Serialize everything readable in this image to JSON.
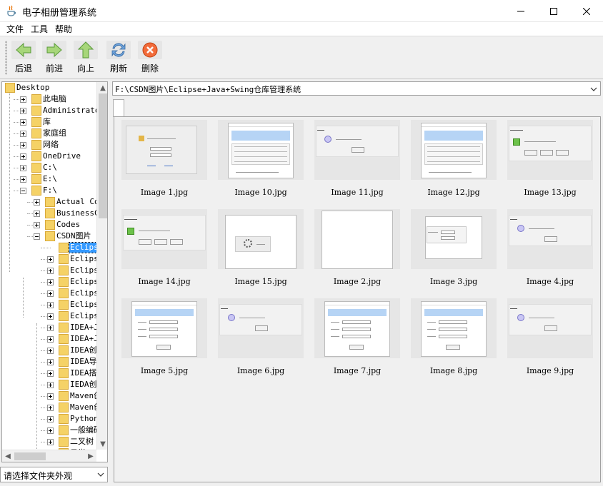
{
  "window": {
    "title": "电子相册管理系统",
    "controls": [
      "minimize",
      "maximize",
      "close"
    ]
  },
  "menu": [
    "文件",
    "工具",
    "帮助"
  ],
  "toolbar": [
    {
      "label": "后退",
      "icon": "back-arrow-icon"
    },
    {
      "label": "前进",
      "icon": "forward-arrow-icon"
    },
    {
      "label": "向上",
      "icon": "up-arrow-icon"
    },
    {
      "label": "刷新",
      "icon": "refresh-icon"
    },
    {
      "label": "删除",
      "icon": "delete-icon"
    }
  ],
  "tree": {
    "items": [
      {
        "label": "Desktop",
        "expanded": true
      },
      {
        "label": "此电脑"
      },
      {
        "label": "Administrator"
      },
      {
        "label": "库"
      },
      {
        "label": "家庭组"
      },
      {
        "label": "网络"
      },
      {
        "label": "OneDrive"
      },
      {
        "label": "C:\\"
      },
      {
        "label": "E:\\"
      },
      {
        "label": "F:\\",
        "expanded": true
      },
      {
        "label": "Actual Combat"
      },
      {
        "label": "BusinessCodes"
      },
      {
        "label": "Codes"
      },
      {
        "label": "CSDN图片",
        "expanded": true
      },
      {
        "label": "Eclipse+J",
        "selected": true
      },
      {
        "label": "Eclipse+J"
      },
      {
        "label": "Eclipse+J"
      },
      {
        "label": "Eclipse+J"
      },
      {
        "label": "Eclipse设"
      },
      {
        "label": "Eclipse配"
      },
      {
        "label": "Eclipse配"
      },
      {
        "label": "IDEA+Java"
      },
      {
        "label": "IDEA+Java"
      },
      {
        "label": "IDEA创建S"
      },
      {
        "label": "IDEA导入J"
      },
      {
        "label": "IDEA搭建S"
      },
      {
        "label": "IEDA创建W"
      },
      {
        "label": "Maven创建"
      },
      {
        "label": "Maven创建"
      },
      {
        "label": "Python安装"
      },
      {
        "label": "一般编码"
      },
      {
        "label": "二叉树"
      },
      {
        "label": "日学"
      }
    ]
  },
  "filter_combo": {
    "value": "请选择文件夹外观"
  },
  "path": {
    "value": "F:\\CSDN图片\\Eclipse+Java+Swing仓库管理系统"
  },
  "images": [
    {
      "name": "Image 1.jpg",
      "kind": "login"
    },
    {
      "name": "Image 10.jpg",
      "kind": "table"
    },
    {
      "name": "Image 11.jpg",
      "kind": "info"
    },
    {
      "name": "Image 12.jpg",
      "kind": "table"
    },
    {
      "name": "Image 13.jpg",
      "kind": "confirm"
    },
    {
      "name": "Image 14.jpg",
      "kind": "confirm"
    },
    {
      "name": "Image 15.jpg",
      "kind": "loading"
    },
    {
      "name": "Image 2.jpg",
      "kind": "blank"
    },
    {
      "name": "Image 3.jpg",
      "kind": "form"
    },
    {
      "name": "Image 4.jpg",
      "kind": "info"
    },
    {
      "name": "Image 5.jpg",
      "kind": "form-window"
    },
    {
      "name": "Image 6.jpg",
      "kind": "info"
    },
    {
      "name": "Image 7.jpg",
      "kind": "form-window"
    },
    {
      "name": "Image 8.jpg",
      "kind": "form-window"
    },
    {
      "name": "Image 9.jpg",
      "kind": "info"
    }
  ]
}
